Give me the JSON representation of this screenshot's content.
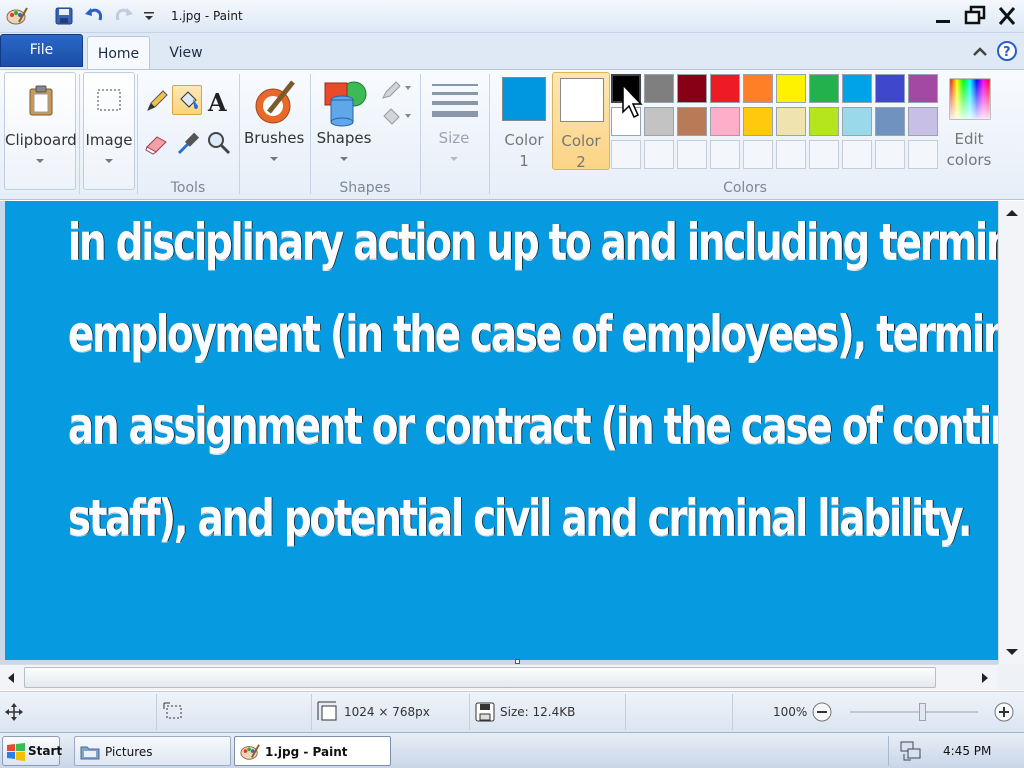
{
  "window": {
    "title": "1.jpg - Paint"
  },
  "ribbon": {
    "file_tab": "File",
    "tabs": [
      "Home",
      "View"
    ],
    "groups": {
      "clipboard": "Clipboard",
      "image": "Image",
      "tools": "Tools",
      "brushes": "Brushes",
      "shapes_button": "Shapes",
      "shapes_group": "Shapes",
      "size": "Size",
      "colors_group": "Colors"
    },
    "color1": {
      "label": "Color",
      "num": "1",
      "value": "#0097e0"
    },
    "color2": {
      "label": "Color",
      "num": "2",
      "value": "#ffffff"
    },
    "edit_colors": [
      "Edit",
      "colors"
    ],
    "palette_row1": [
      "#000000",
      "#7f7f7f",
      "#880015",
      "#ed1c24",
      "#ff7f27",
      "#fff200",
      "#22b14c",
      "#00a2e8",
      "#3f48cc",
      "#a349a4"
    ],
    "palette_row2": [
      "#ffffff",
      "#c3c3c3",
      "#b97a57",
      "#ffaec9",
      "#ffc90e",
      "#efe4b0",
      "#b5e61d",
      "#99d9ea",
      "#7092be",
      "#c8bfe7"
    ]
  },
  "canvas": {
    "background": "#069ae0",
    "lines": [
      "in disciplinary action up to and including termination of",
      "employment (in the case of employees), termination of",
      "an assignment or contract (in the case of contingent",
      "staff), and potential civil and criminal liability."
    ]
  },
  "statusbar": {
    "dimensions": "1024 × 768px",
    "size": "Size: 12.4KB",
    "zoom": "100%"
  },
  "taskbar": {
    "start": "Start",
    "items": [
      "Pictures",
      "1.jpg - Paint"
    ],
    "clock": "4:45 PM"
  }
}
